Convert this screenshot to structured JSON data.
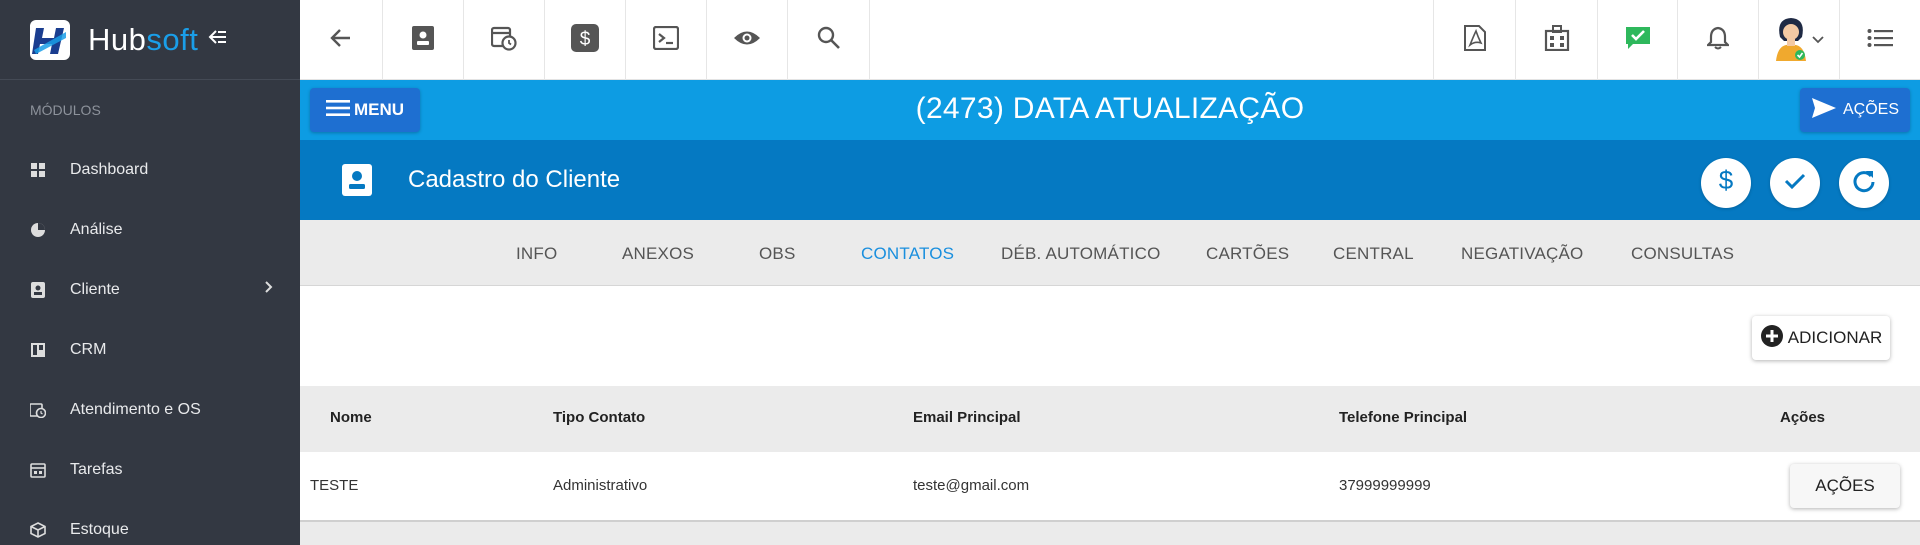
{
  "sidebar": {
    "brand_part1": "Hub",
    "brand_part2": "soft",
    "collapse_icon": "collapse-arrow-icon",
    "section_label": "MÓDULOS",
    "items": [
      {
        "label": "Dashboard",
        "icon": "dashboard-icon"
      },
      {
        "label": "Análise",
        "icon": "pie-chart-icon"
      },
      {
        "label": "Cliente",
        "icon": "contact-card-icon"
      },
      {
        "label": "CRM",
        "icon": "board-icon"
      },
      {
        "label": "Atendimento e OS",
        "icon": "calendar-clock-icon"
      },
      {
        "label": "Tarefas",
        "icon": "task-calendar-icon"
      },
      {
        "label": "Estoque",
        "icon": "box-icon"
      }
    ]
  },
  "topbar": {
    "icons_left": [
      "back-arrow-icon",
      "contact-card-icon",
      "calendar-clock-icon",
      "dollar-icon",
      "terminal-icon",
      "eye-icon",
      "search-icon"
    ],
    "icons_right": [
      "pdf-icon",
      "building-icon",
      "chat-check-icon",
      "bell-icon",
      "user-avatar",
      "list-icon"
    ]
  },
  "banner": {
    "menu_label": "MENU",
    "title": "(2473) DATA ATUALIZAÇÃO",
    "actions_label": "AÇÕES"
  },
  "section": {
    "title": "Cadastro do Cliente"
  },
  "tabs": [
    {
      "label": "INFO",
      "active": false
    },
    {
      "label": "ANEXOS",
      "active": false
    },
    {
      "label": "OBS",
      "active": false
    },
    {
      "label": "CONTATOS",
      "active": true
    },
    {
      "label": "DÉB. AUTOMÁTICO",
      "active": false
    },
    {
      "label": "CARTÕES",
      "active": false
    },
    {
      "label": "CENTRAL",
      "active": false
    },
    {
      "label": "NEGATIVAÇÃO",
      "active": false
    },
    {
      "label": "CONSULTAS",
      "active": false
    }
  ],
  "content": {
    "add_label": "ADICIONAR"
  },
  "table": {
    "columns": [
      "Nome",
      "Tipo Contato",
      "Email Principal",
      "Telefone Principal",
      "Ações"
    ],
    "rows": [
      {
        "nome": "TESTE",
        "tipo": "Administrativo",
        "email": "teste@gmail.com",
        "telefone": "37999999999",
        "acoes_label": "AÇÕES"
      }
    ]
  },
  "colors": {
    "sidebar_bg": "#333842",
    "banner_blue": "#0d9ce3",
    "section_blue": "#0579c2",
    "button_blue": "#1e6fd1",
    "active_tab": "#1a8fde"
  }
}
